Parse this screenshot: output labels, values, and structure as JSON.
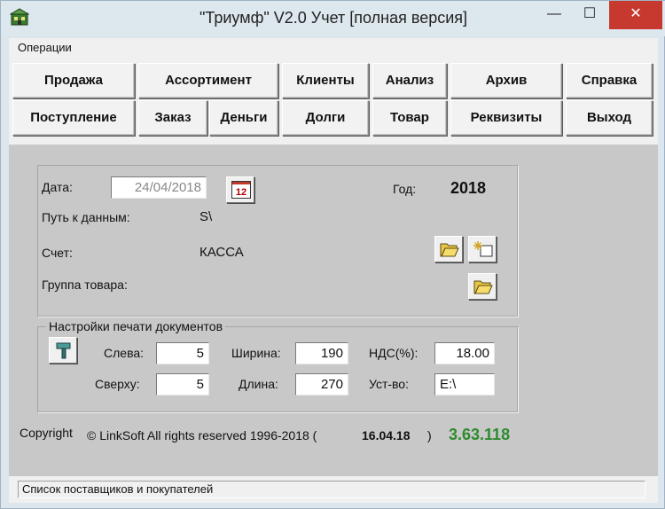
{
  "window": {
    "title": "\"Триумф\" V2.0 Учет [полная версия]",
    "minimize_glyph": "—",
    "maximize_glyph": "☐",
    "close_glyph": "✕"
  },
  "menu": {
    "operations": "Операции"
  },
  "toolbar": {
    "row1": [
      "Продажа",
      "Ассортимент",
      "Клиенты",
      "Анализ",
      "Архив",
      "Справка"
    ],
    "row2": [
      "Поступление",
      "Заказ",
      "Деньги",
      "Долги",
      "Товар",
      "Реквизиты",
      "Выход"
    ]
  },
  "info": {
    "date_label": "Дата:",
    "date_value": "24/04/2018",
    "calendar_button_label": "12",
    "year_label": "Год:",
    "year_value": "2018",
    "path_label": "Путь к данным:",
    "path_value": "S\\",
    "account_label": "Счет:",
    "account_value": "КАССА",
    "group_label": "Группа товара:"
  },
  "print_settings": {
    "title": "Настройки печати документов",
    "left_label": "Слева:",
    "left_value": "5",
    "top_label": "Сверху:",
    "top_value": "5",
    "width_label": "Ширина:",
    "width_value": "190",
    "length_label": "Длина:",
    "length_value": "270",
    "vat_label": "НДС(%):",
    "vat_value": "18.00",
    "device_label": "Уст-во:",
    "device_value": "E:\\"
  },
  "footer": {
    "copyright": "Copyright",
    "company": "© LinkSoft All rights reserved 1996-2018 (",
    "build_date": "16.04.18",
    "close_paren": ")",
    "version": "3.63.118"
  },
  "status": {
    "text": "Список поставщиков и покупателей"
  },
  "colors": {
    "version_green": "#2e8b2e",
    "close_red": "#c7392f"
  },
  "icons": [
    "app-icon",
    "calendar-icon",
    "folder-open-icon",
    "new-item-icon",
    "folder-open-icon",
    "hammer-icon"
  ]
}
